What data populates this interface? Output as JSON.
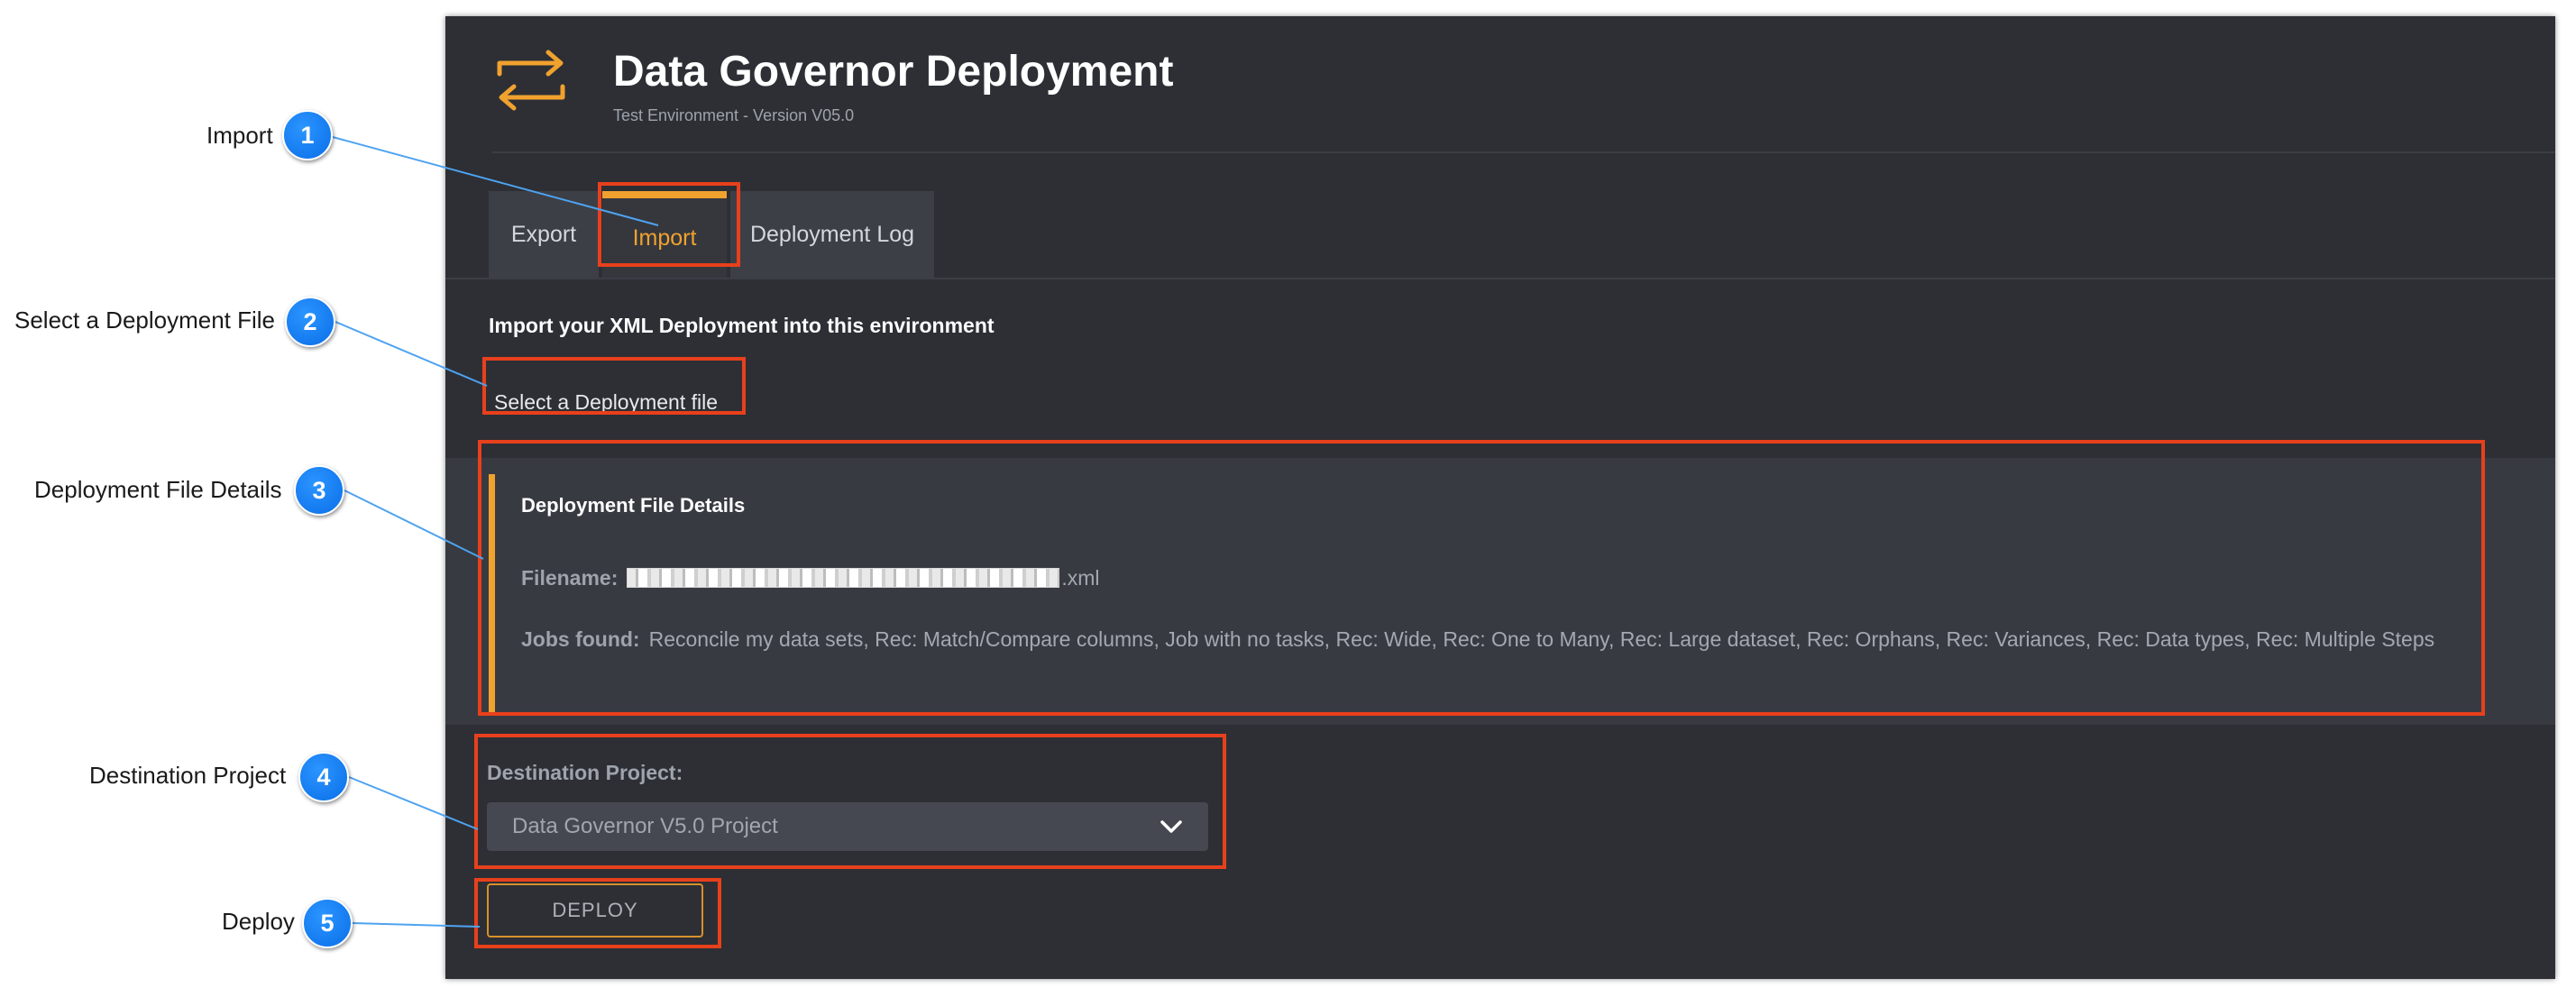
{
  "app": {
    "title": "Data Governor Deployment",
    "subtitle": "Test Environment - Version V05.0"
  },
  "tabs": [
    {
      "label": "Export",
      "active": false
    },
    {
      "label": "Import",
      "active": true
    },
    {
      "label": "Deployment Log",
      "active": false
    }
  ],
  "import": {
    "heading": "Import your XML Deployment into this environment",
    "select_file_label": "Select a Deployment file",
    "details": {
      "title": "Deployment File Details",
      "filename_label": "Filename:",
      "filename_value": ".xml",
      "jobs_label": "Jobs found:",
      "jobs_value": "Reconcile my data sets, Rec: Match/Compare columns, Job with no tasks, Rec: Wide, Rec: One to Many, Rec: Large dataset, Rec: Orphans, Rec: Variances, Rec: Data types, Rec: Multiple Steps"
    },
    "destination_label": "Destination Project:",
    "destination_value": "Data Governor V5.0 Project",
    "deploy_label": "DEPLOY"
  },
  "callouts": [
    {
      "number": "1",
      "label": "Import"
    },
    {
      "number": "2",
      "label": "Select a Deployment File"
    },
    {
      "number": "3",
      "label": "Deployment File Details"
    },
    {
      "number": "4",
      "label": "Destination Project"
    },
    {
      "number": "5",
      "label": "Deploy"
    }
  ],
  "colors": {
    "accent": "#f0a22e",
    "highlight": "#e8401c",
    "badge": "#0a6ee8",
    "background": "#2d2f35"
  },
  "icons": {
    "logo": "swap-arrows-icon",
    "dropdown": "chevron-down-icon",
    "redaction": "redacted-filename"
  }
}
